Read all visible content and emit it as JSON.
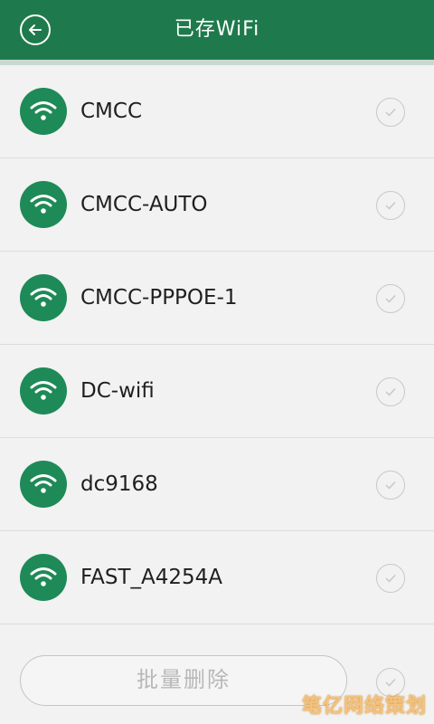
{
  "header": {
    "title": "已存WiFi",
    "back_icon": "arrow-left-icon",
    "bg_color": "#1e7a4c"
  },
  "networks": [
    {
      "ssid": "CMCC"
    },
    {
      "ssid": "CMCC-AUTO"
    },
    {
      "ssid": "CMCC-PPPOE-1"
    },
    {
      "ssid": "DC-wifi"
    },
    {
      "ssid": "dc9168"
    },
    {
      "ssid": "FAST_A4254A"
    }
  ],
  "footer": {
    "batch_delete_label": "批量删除"
  },
  "watermark": {
    "text": "笔亿网络策划"
  },
  "colors": {
    "accent": "#1e8a57",
    "check_border": "#c8c8c8"
  }
}
